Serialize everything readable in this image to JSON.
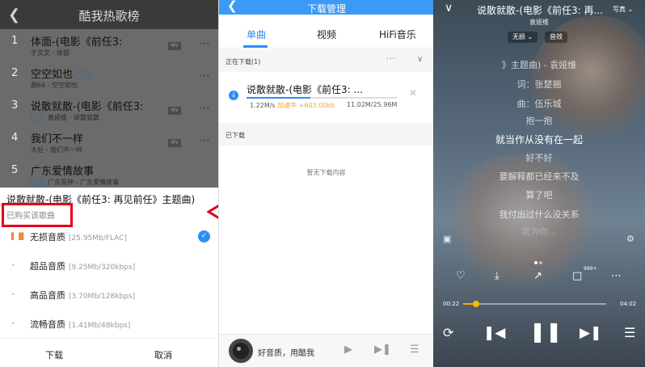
{
  "panel1": {
    "header_title": "酷我热歌榜",
    "back_icon": "chevron-left-icon",
    "songs": [
      {
        "rank": "1",
        "name": "体面-(电影《前任3:",
        "tag": "",
        "sub": "于文文 - 体面",
        "mv": "MV"
      },
      {
        "rank": "2",
        "name": "空空如也",
        "tag": "无损",
        "sub": "胡66 - 空空如也",
        "mv": ""
      },
      {
        "rank": "3",
        "name": "说散就散-(电影《前任3:",
        "tag": "无损",
        "sub": "袁娅维 - 说散就散",
        "mv": "MV"
      },
      {
        "rank": "4",
        "name": "我们不一样",
        "tag": "",
        "sub": "大壮 - 我们不一样",
        "mv": "MV"
      },
      {
        "rank": "5",
        "name": "广东爱情故事",
        "tag": "无损",
        "sub": "广东雨神 - 广东爱情故事",
        "mv": ""
      }
    ],
    "sheet": {
      "song_title": "说散就散-(电影《前任3: 再见前任》主题曲)",
      "purchased": "已购买该歌曲",
      "qualities": [
        {
          "name": "无损音质",
          "detail": "[25.95Mb/FLAC]",
          "selected": true
        },
        {
          "name": "超品音质",
          "detail": "[9.25Mb/320kbps]",
          "selected": false
        },
        {
          "name": "高品音质",
          "detail": "[3.70Mb/128kbps]",
          "selected": false
        },
        {
          "name": "流畅音质",
          "detail": "[1.41Mb/48kbps]",
          "selected": false
        }
      ],
      "download_label": "下载",
      "cancel_label": "取消"
    }
  },
  "panel2": {
    "header_title": "下载管理",
    "tabs": [
      "单曲",
      "视频",
      "HiFi音乐"
    ],
    "active_tab": "单曲",
    "downloading_label": "正在下载(1)",
    "downloading_item": {
      "name": "说散就散-(电影《前任3: ...",
      "speed": "1.22M/s",
      "accel": "加速中 +603.00kb",
      "size": "11.02M/25.96M",
      "progress": 0.424
    },
    "downloaded_label": "已下载",
    "empty_text": "暂无下载内容",
    "player": {
      "text": "好音质，用酷我"
    }
  },
  "panel3": {
    "title": "说散就散-(电影《前任3: 再...",
    "write_label": "写真",
    "artist": "袁娅维",
    "pill_quality": "无损",
    "pill_effect": "音效",
    "lyrics": [
      "》主题曲) - 袁娅维",
      "词：张楚翘",
      "曲：伍乐城",
      "抱一抱",
      "就当作从没有在一起",
      "好不好",
      "要解释都已经来不及",
      "算了吧",
      "我付出过什么没关系",
      "我为你..."
    ],
    "current_lyric_index": 4,
    "comment_badge": "999+",
    "time_current": "00:22",
    "time_total": "04:02",
    "playback_progress": 0.09,
    "accent_color": "#f5a623"
  },
  "colors": {
    "accent_blue": "#2c8ef8",
    "highlight_red": "#e60012"
  }
}
